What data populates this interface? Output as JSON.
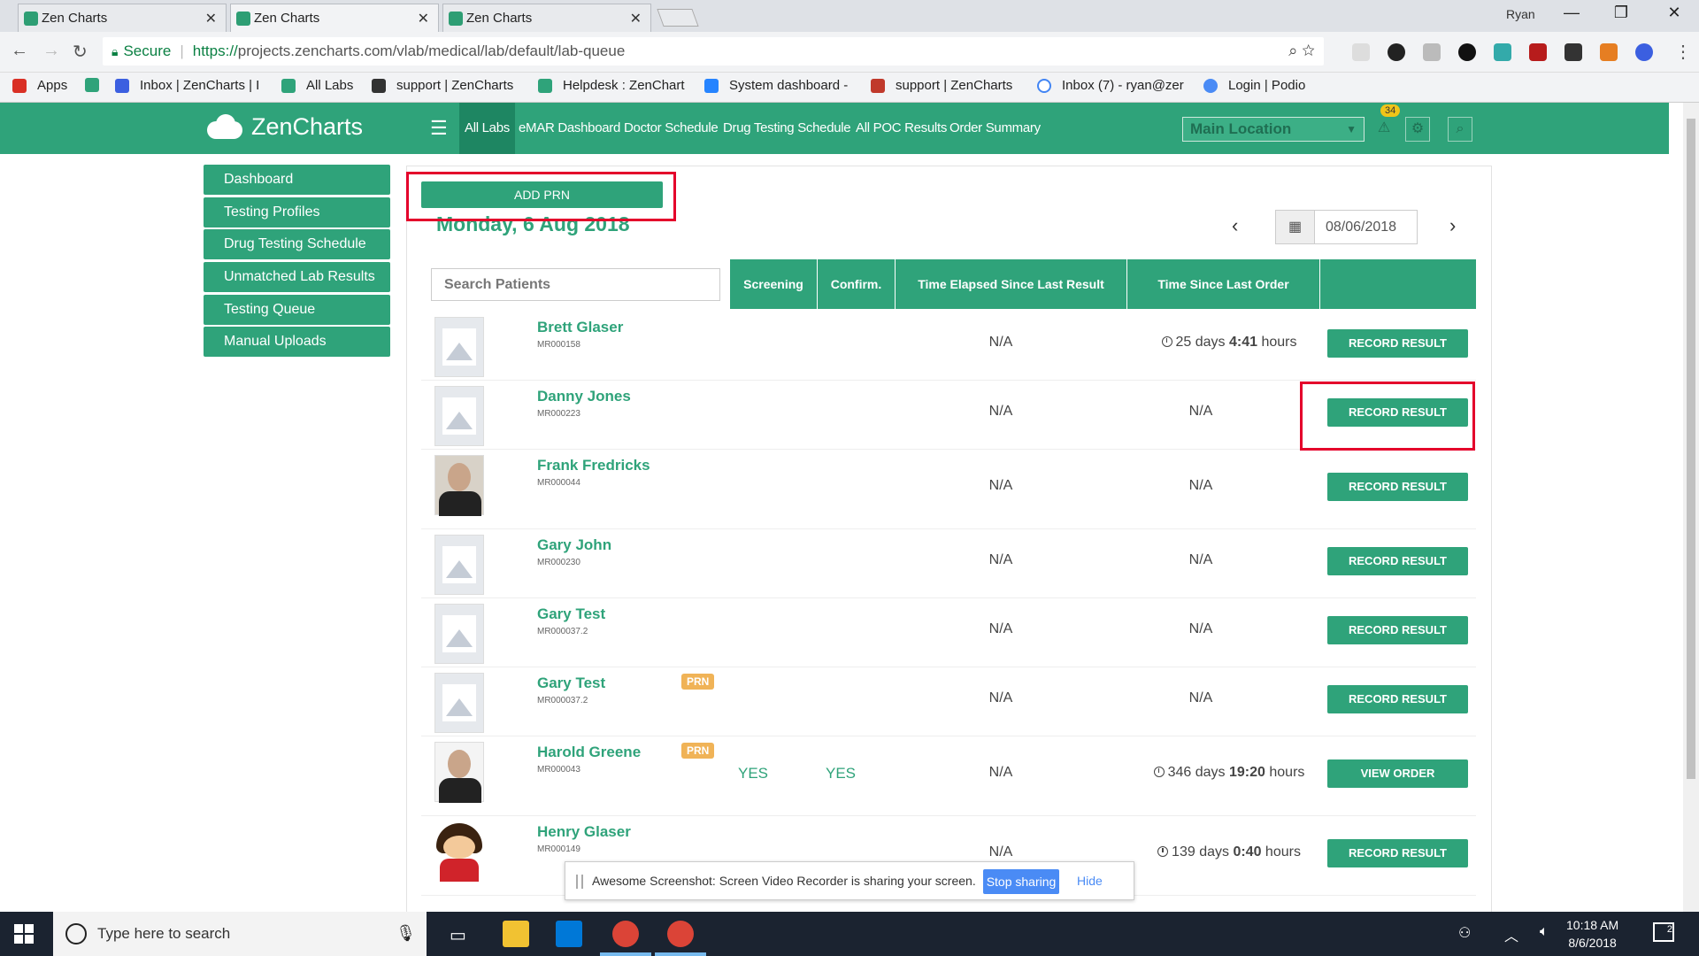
{
  "browser": {
    "tabs": [
      {
        "title": "Zen Charts"
      },
      {
        "title": "Zen Charts"
      },
      {
        "title": "Zen Charts"
      }
    ],
    "user": "Ryan",
    "secure_label": "Secure",
    "url_scheme": "https://",
    "url_rest": "projects.zenchart​s.com/vlab/medical/lab/default/lab-queue",
    "bookmarks": [
      {
        "label": "Apps"
      },
      {
        "label": "Inbox | ZenCharts | I"
      },
      {
        "label": "All Labs"
      },
      {
        "label": "support | ZenCharts"
      },
      {
        "label": "Helpdesk : ZenChart"
      },
      {
        "label": "System dashboard -"
      },
      {
        "label": "support | ZenCharts"
      },
      {
        "label": "Inbox (7) - ryan@zer"
      },
      {
        "label": "Login | Podio"
      }
    ]
  },
  "header": {
    "logo_text": "ZenCharts",
    "nav": [
      {
        "label": "All Labs"
      },
      {
        "label": "eMAR Dashboard"
      },
      {
        "label": "Doctor Schedule"
      },
      {
        "label": "Drug Testing Schedule"
      },
      {
        "label": "All POC Results"
      },
      {
        "label": "Order Summary"
      }
    ],
    "location": "Main Location",
    "alert_count": "34"
  },
  "sidebar": {
    "items": [
      {
        "label": "Dashboard"
      },
      {
        "label": "Testing Profiles"
      },
      {
        "label": "Drug Testing Schedule"
      },
      {
        "label": "Unmatched Lab Results"
      },
      {
        "label": "Testing Queue"
      },
      {
        "label": "Manual Uploads"
      }
    ]
  },
  "main": {
    "add_prn_label": "ADD PRN",
    "date_title": "Monday, 6 Aug 2018",
    "date_value": "08/06/2018",
    "search_placeholder": "Search Patients",
    "columns": [
      "Screening",
      "Confirm.",
      "Time Elapsed Since Last Result",
      "Time Since Last Order"
    ],
    "rows": [
      {
        "name": "Brett Glaser",
        "mrn": "MR000158",
        "prn": "",
        "screening": "",
        "confirm": "",
        "elapsed": "N/A",
        "since_order_pre": "25 days ",
        "since_order_bold": "4:41",
        "since_order_post": " hours",
        "action": "RECORD RESULT"
      },
      {
        "name": "Danny Jones",
        "mrn": "MR000223",
        "prn": "",
        "screening": "",
        "confirm": "",
        "elapsed": "N/A",
        "since_order": "N/A",
        "action": "RECORD RESULT"
      },
      {
        "name": "Frank Fredricks",
        "mrn": "MR000044",
        "prn": "",
        "screening": "",
        "confirm": "",
        "elapsed": "N/A",
        "since_order": "N/A",
        "action": "RECORD RESULT"
      },
      {
        "name": "Gary John",
        "mrn": "MR000230",
        "prn": "",
        "screening": "",
        "confirm": "",
        "elapsed": "N/A",
        "since_order": "N/A",
        "action": "RECORD RESULT"
      },
      {
        "name": "Gary Test",
        "mrn": "MR000037.2",
        "prn": "",
        "screening": "",
        "confirm": "",
        "elapsed": "N/A",
        "since_order": "N/A",
        "action": "RECORD RESULT"
      },
      {
        "name": "Gary Test",
        "mrn": "MR000037.2",
        "prn": "PRN",
        "screening": "",
        "confirm": "",
        "elapsed": "N/A",
        "since_order": "N/A",
        "action": "RECORD RESULT"
      },
      {
        "name": "Harold Greene",
        "mrn": "MR000043",
        "prn": "PRN",
        "screening": "YES",
        "confirm": "YES",
        "elapsed": "N/A",
        "since_order_pre": "346 days ",
        "since_order_bold": "19:20",
        "since_order_post": " hours",
        "action": "VIEW ORDER"
      },
      {
        "name": "Henry Glaser",
        "mrn": "MR000149",
        "prn": "",
        "screening": "",
        "confirm": "",
        "elapsed": "N/A",
        "since_order_pre": "139 days ",
        "since_order_bold": "0:40",
        "since_order_post": " hours",
        "action": "RECORD RESULT"
      }
    ]
  },
  "share_bar": {
    "message": "Awesome Screenshot: Screen Video Recorder is sharing your screen.",
    "stop_label": "Stop sharing",
    "hide_label": "Hide"
  },
  "taskbar": {
    "search_placeholder": "Type here to search",
    "time": "10:18 AM",
    "date": "8/6/2018",
    "notification_count": "2"
  }
}
